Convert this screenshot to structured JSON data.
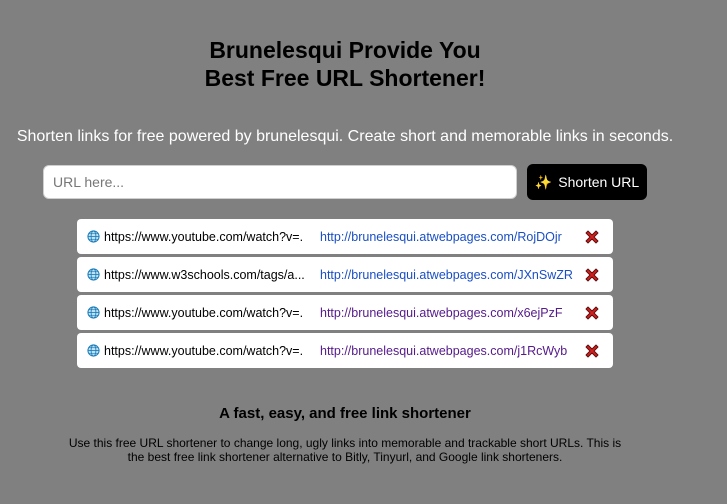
{
  "header": {
    "title_line1": "Brunelesqui Provide You",
    "title_line2": "Best Free URL Shortener!",
    "subtitle": "Shorten links for free powered by brunelesqui. Create short and memorable links in seconds."
  },
  "form": {
    "input_value": "",
    "input_placeholder": "URL here...",
    "button_label": "Shorten URL",
    "button_icon": "sparkles-icon"
  },
  "links": [
    {
      "original": "https://www.youtube.com/watch?v=...",
      "short": "http://brunelesqui.atwebpages.com/RojDOjr",
      "visited": false
    },
    {
      "original": "https://www.w3schools.com/tags/a...",
      "short": "http://brunelesqui.atwebpages.com/JXnSwZR",
      "visited": false
    },
    {
      "original": "https://www.youtube.com/watch?v=...",
      "short": "http://brunelesqui.atwebpages.com/x6ejPzF",
      "visited": true
    },
    {
      "original": "https://www.youtube.com/watch?v=...",
      "short": "http://brunelesqui.atwebpages.com/j1RcWyb",
      "visited": true
    }
  ],
  "info": {
    "heading": "A fast, easy, and free link shortener",
    "text": "Use this free URL shortener to change long, ugly links into memorable and trackable short URLs. This is the best free link shortener alternative to Bitly, Tinyurl, and Google link shorteners."
  },
  "colors": {
    "background": "#808080",
    "button": "#000000",
    "link": "#1a4fc4",
    "link_visited": "#551a8b",
    "delete": "#d22020"
  }
}
